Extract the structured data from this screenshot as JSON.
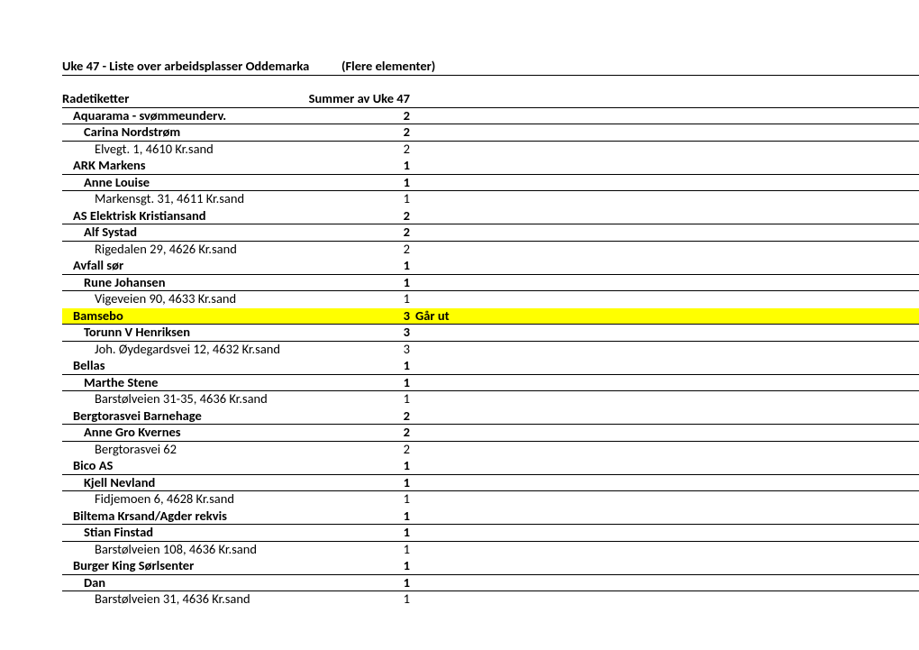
{
  "title_row": {
    "label": "Uke 47 - Liste over arbeidsplasser Oddemarka",
    "value": "(Flere elementer)"
  },
  "header_row": {
    "label": "Radetiketter",
    "value": "Summer av Uke 47"
  },
  "rows": [
    {
      "indent": 1,
      "label": "Aquarama - svømmeunderv.",
      "value": "2",
      "note": "",
      "bold": true,
      "line": true,
      "highlight": ""
    },
    {
      "indent": 2,
      "label": "Carina Nordstrøm",
      "value": "2",
      "note": "",
      "bold": true,
      "line": true,
      "highlight": ""
    },
    {
      "indent": 3,
      "label": "Elvegt. 1, 4610 Kr.sand",
      "value": "2",
      "note": "",
      "bold": false,
      "line": false,
      "highlight": ""
    },
    {
      "indent": 1,
      "label": "ARK Markens",
      "value": "1",
      "note": "",
      "bold": true,
      "line": true,
      "highlight": ""
    },
    {
      "indent": 2,
      "label": "Anne Louise",
      "value": "1",
      "note": "",
      "bold": true,
      "line": true,
      "highlight": ""
    },
    {
      "indent": 3,
      "label": "Markensgt. 31, 4611 Kr.sand",
      "value": "1",
      "note": "",
      "bold": false,
      "line": false,
      "highlight": ""
    },
    {
      "indent": 1,
      "label": "AS Elektrisk Kristiansand",
      "value": "2",
      "note": "",
      "bold": true,
      "line": true,
      "highlight": ""
    },
    {
      "indent": 2,
      "label": "Alf Systad",
      "value": "2",
      "note": "",
      "bold": true,
      "line": true,
      "highlight": ""
    },
    {
      "indent": 3,
      "label": "Rigedalen 29, 4626 Kr.sand",
      "value": "2",
      "note": "",
      "bold": false,
      "line": false,
      "highlight": ""
    },
    {
      "indent": 1,
      "label": "Avfall sør",
      "value": "1",
      "note": "",
      "bold": true,
      "line": true,
      "highlight": ""
    },
    {
      "indent": 2,
      "label": "Rune Johansen",
      "value": "1",
      "note": "",
      "bold": true,
      "line": true,
      "highlight": ""
    },
    {
      "indent": 3,
      "label": "Vigeveien 90, 4633 Kr.sand",
      "value": "1",
      "note": "",
      "bold": false,
      "line": false,
      "highlight": ""
    },
    {
      "indent": 1,
      "label": "Bamsebo",
      "value": "3",
      "note": "Går ut",
      "bold": true,
      "line": true,
      "highlight": "yellow"
    },
    {
      "indent": 2,
      "label": "Torunn V Henriksen",
      "value": "3",
      "note": "",
      "bold": true,
      "line": true,
      "highlight": ""
    },
    {
      "indent": 3,
      "label": "Joh. Øydegardsvei 12, 4632 Kr.sand",
      "value": "3",
      "note": "",
      "bold": false,
      "line": false,
      "highlight": ""
    },
    {
      "indent": 1,
      "label": "Bellas",
      "value": "1",
      "note": "",
      "bold": true,
      "line": true,
      "highlight": ""
    },
    {
      "indent": 2,
      "label": "Marthe Stene",
      "value": "1",
      "note": "",
      "bold": true,
      "line": true,
      "highlight": ""
    },
    {
      "indent": 3,
      "label": "Barstølveien 31-35, 4636 Kr.sand",
      "value": "1",
      "note": "",
      "bold": false,
      "line": false,
      "highlight": ""
    },
    {
      "indent": 1,
      "label": "Bergtorasvei Barnehage",
      "value": "2",
      "note": "",
      "bold": true,
      "line": true,
      "highlight": ""
    },
    {
      "indent": 2,
      "label": "Anne Gro Kvernes",
      "value": "2",
      "note": "",
      "bold": true,
      "line": true,
      "highlight": ""
    },
    {
      "indent": 3,
      "label": "Bergtorasvei 62",
      "value": "2",
      "note": "",
      "bold": false,
      "line": false,
      "highlight": ""
    },
    {
      "indent": 1,
      "label": "Bico AS",
      "value": "1",
      "note": "",
      "bold": true,
      "line": true,
      "highlight": ""
    },
    {
      "indent": 2,
      "label": "Kjell Nevland",
      "value": "1",
      "note": "",
      "bold": true,
      "line": true,
      "highlight": ""
    },
    {
      "indent": 3,
      "label": "Fidjemoen 6, 4628 Kr.sand",
      "value": "1",
      "note": "",
      "bold": false,
      "line": false,
      "highlight": ""
    },
    {
      "indent": 1,
      "label": "Biltema Krsand/Agder rekvis",
      "value": "1",
      "note": "",
      "bold": true,
      "line": true,
      "highlight": ""
    },
    {
      "indent": 2,
      "label": "Stian Finstad",
      "value": "1",
      "note": "",
      "bold": true,
      "line": true,
      "highlight": ""
    },
    {
      "indent": 3,
      "label": "Barstølveien 108, 4636 Kr.sand",
      "value": "1",
      "note": "",
      "bold": false,
      "line": false,
      "highlight": ""
    },
    {
      "indent": 1,
      "label": "Burger King Sørlsenter",
      "value": "1",
      "note": "",
      "bold": true,
      "line": true,
      "highlight": ""
    },
    {
      "indent": 2,
      "label": "Dan",
      "value": "1",
      "note": "",
      "bold": true,
      "line": true,
      "highlight": ""
    },
    {
      "indent": 3,
      "label": "Barstølveien 31, 4636 Kr.sand",
      "value": "1",
      "note": "",
      "bold": false,
      "line": false,
      "highlight": ""
    }
  ]
}
